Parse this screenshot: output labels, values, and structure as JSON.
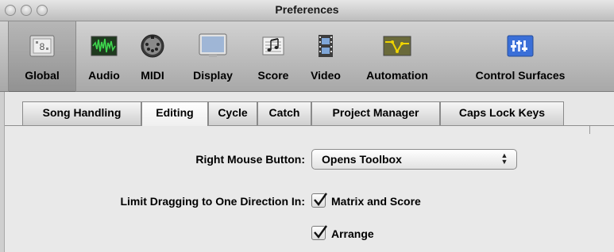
{
  "window": {
    "title": "Preferences"
  },
  "toolbar": {
    "items": [
      {
        "label": "Global",
        "icon": "global-icon",
        "selected": true
      },
      {
        "label": "Audio",
        "icon": "audio-waveform-icon",
        "selected": false
      },
      {
        "label": "MIDI",
        "icon": "midi-connector-icon",
        "selected": false
      },
      {
        "label": "Display",
        "icon": "display-monitor-icon",
        "selected": false
      },
      {
        "label": "Score",
        "icon": "score-notes-icon",
        "selected": false
      },
      {
        "label": "Video",
        "icon": "video-film-icon",
        "selected": false
      },
      {
        "label": "Automation",
        "icon": "automation-curve-icon",
        "selected": false
      },
      {
        "label": "Control Surfaces",
        "icon": "control-surfaces-icon",
        "selected": false
      }
    ]
  },
  "tabs": [
    {
      "label": "Song Handling",
      "selected": false
    },
    {
      "label": "Editing",
      "selected": true
    },
    {
      "label": "Cycle",
      "selected": false
    },
    {
      "label": "Catch",
      "selected": false
    },
    {
      "label": "Project Manager",
      "selected": false
    },
    {
      "label": "Caps Lock Keys",
      "selected": false
    }
  ],
  "editing": {
    "right_mouse_label": "Right Mouse Button:",
    "right_mouse_value": "Opens Toolbox",
    "limit_drag_label": "Limit Dragging to One Direction In:",
    "matrix_score_label": "Matrix and Score",
    "matrix_score_checked": true,
    "arrange_label": "Arrange",
    "arrange_checked": true
  },
  "colors": {
    "automation_accent": "#e6c800",
    "audio_accent": "#2fae3c",
    "control_surfaces_accent": "#3a6fd8"
  }
}
